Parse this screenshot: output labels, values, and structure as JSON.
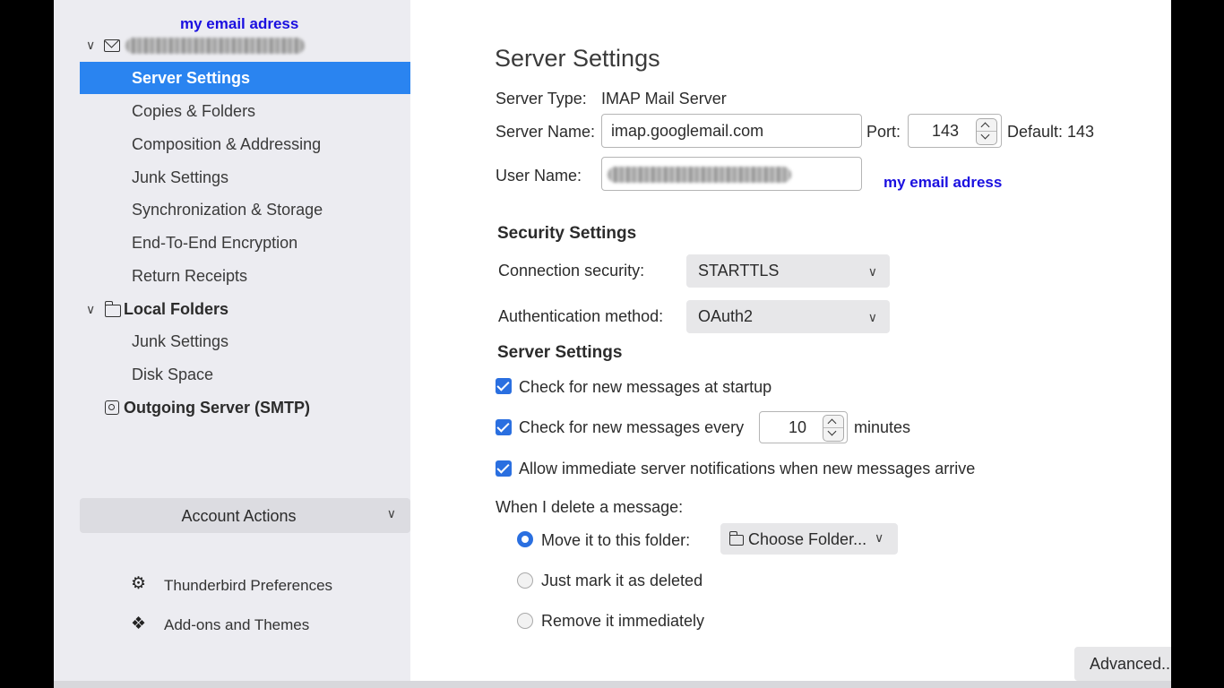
{
  "annotations": {
    "sidebar_note": "my email adress",
    "username_note": "my email adress"
  },
  "sidebar": {
    "selected_item": "Server Settings",
    "account_items": [
      "Copies & Folders",
      "Composition & Addressing",
      "Junk Settings",
      "Synchronization & Storage",
      "End-To-End Encryption",
      "Return Receipts"
    ],
    "local_folders": {
      "label": "Local Folders",
      "items": [
        "Junk Settings",
        "Disk Space"
      ]
    },
    "outgoing": "Outgoing Server (SMTP)",
    "account_actions": "Account Actions",
    "preferences": "Thunderbird Preferences",
    "addons": "Add-ons and Themes"
  },
  "main": {
    "title": "Server Settings",
    "server_type_label": "Server Type:",
    "server_type_value": "IMAP Mail Server",
    "server_name_label": "Server Name:",
    "server_name_value": "imap.googlemail.com",
    "port_label": "Port:",
    "port_value": "143",
    "default_label": "Default: 143",
    "user_name_label": "User Name:",
    "security_heading": "Security Settings",
    "connection_security_label": "Connection security:",
    "connection_security_value": "STARTTLS",
    "auth_method_label": "Authentication method:",
    "auth_method_value": "OAuth2",
    "server_heading": "Server Settings",
    "check_startup": "Check for new messages at startup",
    "check_every": "Check for new messages every",
    "check_every_value": "10",
    "minutes": "minutes",
    "allow_notifications": "Allow immediate server notifications when new messages arrive",
    "delete_label": "When I delete a message:",
    "move_folder": "Move it to this folder:",
    "choose_folder": "Choose Folder...",
    "mark_deleted": "Just mark it as deleted",
    "remove_immediately": "Remove it immediately",
    "advanced": "Advanced..."
  },
  "colors": {
    "accent": "#2a84f0",
    "checkbox": "#2a6fe0",
    "annotation": "#1a0fe0"
  }
}
